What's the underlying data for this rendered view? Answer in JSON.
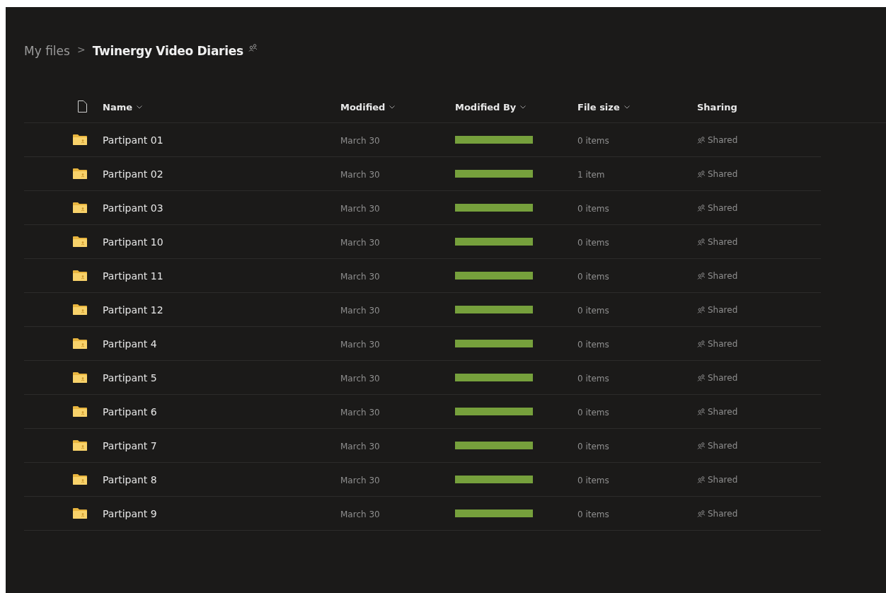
{
  "breadcrumb": {
    "parent": "My files",
    "separator": ">",
    "current": "Twinergy Video Diaries"
  },
  "columns": [
    {
      "label": "Name",
      "sortable": true
    },
    {
      "label": "Modified",
      "sortable": true
    },
    {
      "label": "Modified By",
      "sortable": true
    },
    {
      "label": "File size",
      "sortable": true
    },
    {
      "label": "Sharing",
      "sortable": false
    }
  ],
  "rows": [
    {
      "name": "Partipant 01",
      "modified": "March 30",
      "file_size": "0 items",
      "sharing": "Shared"
    },
    {
      "name": "Partipant 02",
      "modified": "March 30",
      "file_size": "1 item",
      "sharing": "Shared"
    },
    {
      "name": "Partipant 03",
      "modified": "March 30",
      "file_size": "0 items",
      "sharing": "Shared"
    },
    {
      "name": "Partipant 10",
      "modified": "March 30",
      "file_size": "0 items",
      "sharing": "Shared"
    },
    {
      "name": "Partipant 11",
      "modified": "March 30",
      "file_size": "0 items",
      "sharing": "Shared"
    },
    {
      "name": "Partipant 12",
      "modified": "March 30",
      "file_size": "0 items",
      "sharing": "Shared"
    },
    {
      "name": "Partipant 4",
      "modified": "March 30",
      "file_size": "0 items",
      "sharing": "Shared"
    },
    {
      "name": "Partipant 5",
      "modified": "March 30",
      "file_size": "0 items",
      "sharing": "Shared"
    },
    {
      "name": "Partipant 6",
      "modified": "March 30",
      "file_size": "0 items",
      "sharing": "Shared"
    },
    {
      "name": "Partipant 7",
      "modified": "March 30",
      "file_size": "0 items",
      "sharing": "Shared"
    },
    {
      "name": "Partipant 8",
      "modified": "March 30",
      "file_size": "0 items",
      "sharing": "Shared"
    },
    {
      "name": "Partipant 9",
      "modified": "March 30",
      "file_size": "0 items",
      "sharing": "Shared"
    }
  ]
}
